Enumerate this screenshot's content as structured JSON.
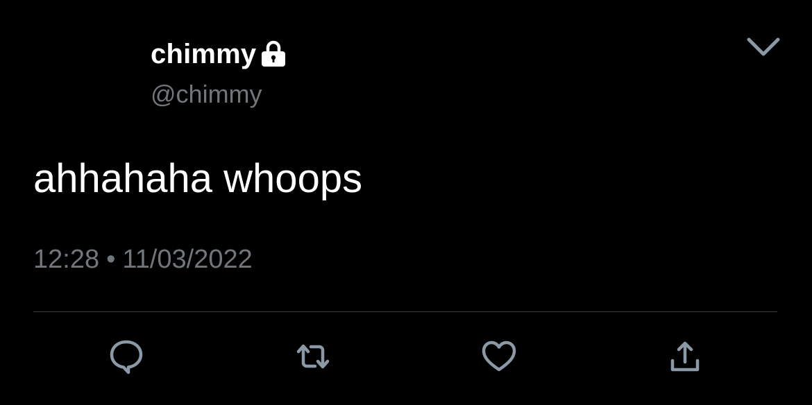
{
  "tweet": {
    "display_name": "chimmy",
    "handle": "@chimmy",
    "text": "ahhahaha whoops",
    "time": "12:28",
    "separator": "•",
    "date": "11/03/2022"
  },
  "icons": {
    "protected": "lock-icon",
    "menu": "chevron-down-icon",
    "reply": "reply-icon",
    "retweet": "retweet-icon",
    "like": "heart-icon",
    "share": "share-icon"
  },
  "colors": {
    "background": "#000000",
    "primary_text": "#ffffff",
    "secondary_text": "#71767b",
    "divider": "#3a3d41",
    "icon": "#8b98a5"
  }
}
